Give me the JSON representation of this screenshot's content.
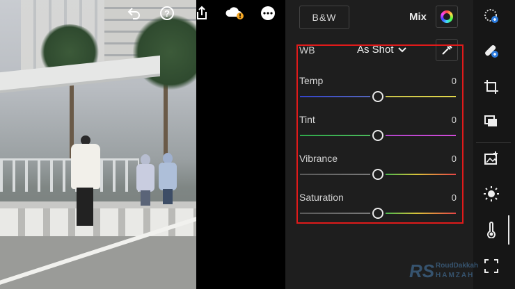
{
  "toolbar": {
    "icons": [
      "undo-icon",
      "help-icon",
      "share-icon",
      "cloud-sync-alert-icon",
      "more-icon"
    ]
  },
  "panel": {
    "bw_label": "B&W",
    "mix_label": "Mix",
    "wb_label": "WB",
    "wb_value": "As Shot",
    "sliders": [
      {
        "label": "Temp",
        "value": "0",
        "position": 0.5
      },
      {
        "label": "Tint",
        "value": "0",
        "position": 0.5
      },
      {
        "label": "Vibrance",
        "value": "0",
        "position": 0.5
      },
      {
        "label": "Saturation",
        "value": "0",
        "position": 0.5
      }
    ]
  },
  "rail": {
    "icons": [
      "presets-icon",
      "healing-icon",
      "crop-icon",
      "versions-icon",
      "photo-add-icon",
      "light-icon",
      "color-icon",
      "effects-icon"
    ]
  },
  "watermark": {
    "logo": "RS",
    "line1": "RoudDakkah",
    "line2": "HAMZAH"
  },
  "colors": {
    "highlight": "#e01a1a",
    "panel_bg": "#1e1e1e",
    "badge": "#f5a623"
  }
}
